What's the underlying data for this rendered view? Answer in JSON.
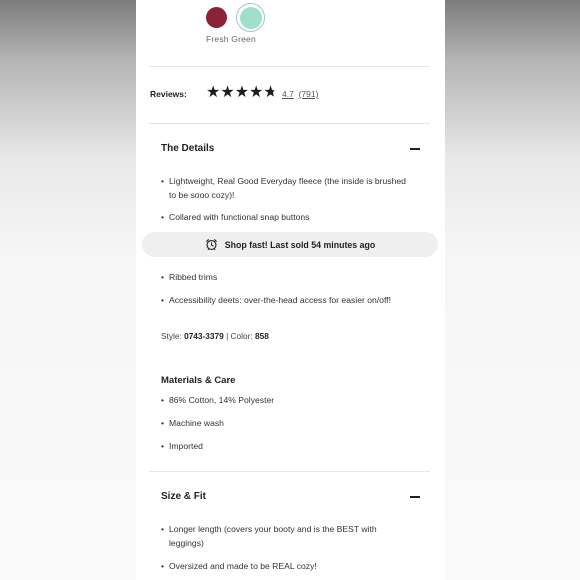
{
  "color": {
    "selected_name": "Fresh Green",
    "swatch_colors": [
      "#8c2235",
      "#9ee0cb"
    ]
  },
  "reviews": {
    "label": "Reviews:",
    "rating": "4.7",
    "count": "(791)",
    "stars_value": 4.7
  },
  "details": {
    "title": "The Details",
    "bullets": [
      "Lightweight, Real Good Everyday fleece (the inside is brushed to be sooo cozy)!",
      "Collared with functional snap buttons",
      "Ribbed trims",
      "Accessibility deets: over-the-head access for easier on/off!"
    ],
    "style_label": "Style:",
    "style_value": "0743-3379",
    "color_label": "| Color:",
    "color_value": "858"
  },
  "materials": {
    "title": "Materials & Care",
    "bullets": [
      "86% Cotton, 14% Polyester",
      "Machine wash",
      "Imported"
    ]
  },
  "size_fit": {
    "title": "Size & Fit",
    "bullets": [
      "Longer length (covers your booty and is the BEST with leggings)",
      "Oversized and made to be REAL cozy!"
    ]
  },
  "toast": {
    "text": "Shop fast! Last sold 54 minutes ago",
    "icon": "alarm-clock-icon"
  }
}
